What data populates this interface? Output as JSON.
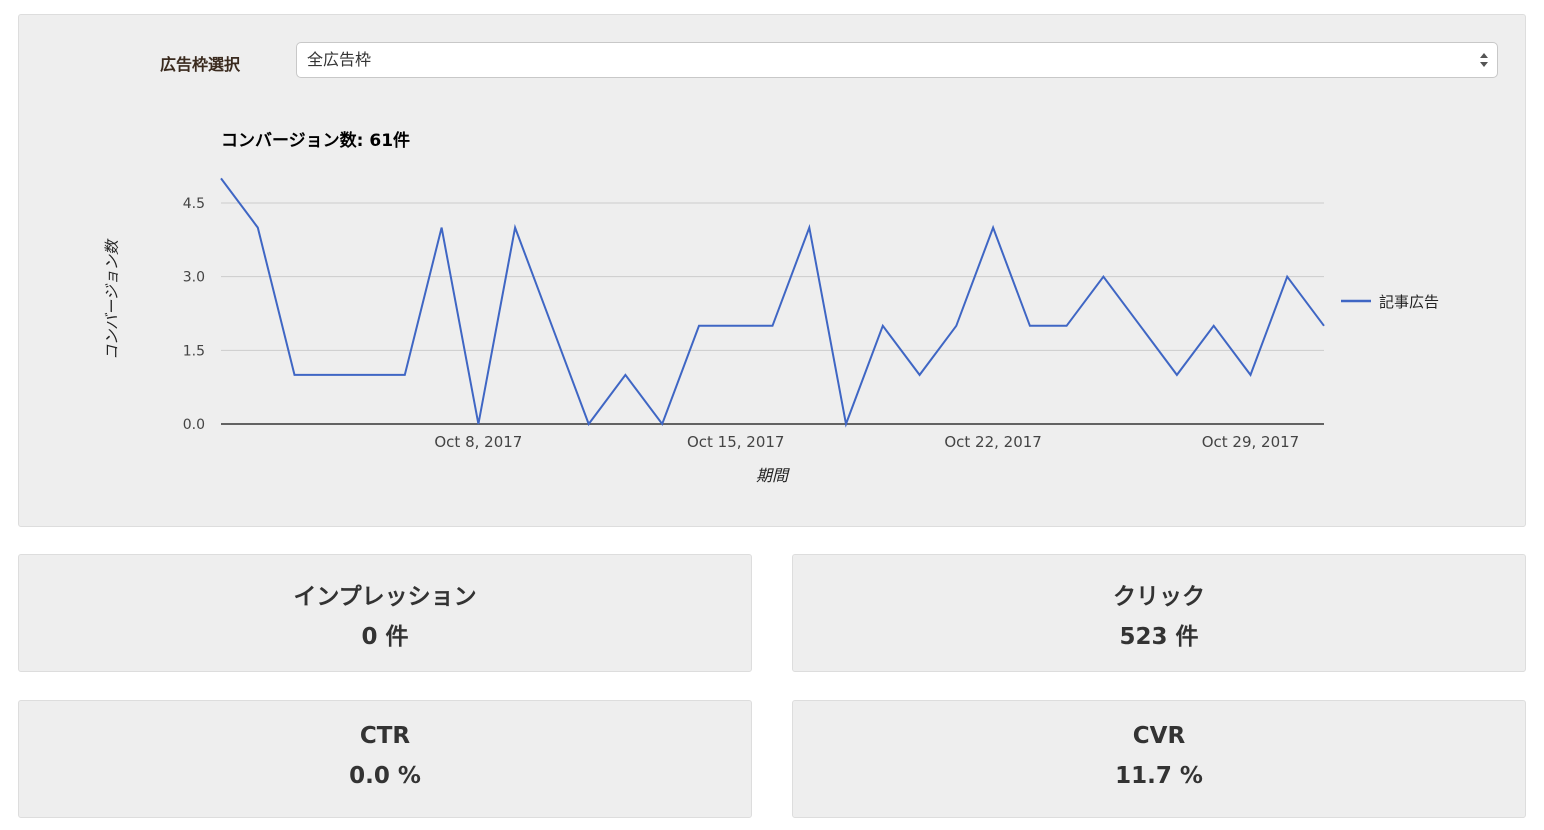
{
  "selector": {
    "label": "広告枠選択",
    "selected": "全広告枠"
  },
  "chart_data": {
    "type": "line",
    "title": "コンバージョン数: 61件",
    "xlabel": "期間",
    "ylabel": "コンバージョン数",
    "ylim": [
      0,
      4.5
    ],
    "yticks": [
      "0.0",
      "1.5",
      "3.0",
      "4.5"
    ],
    "xtick_labels": [
      "Oct 8, 2017",
      "Oct 15, 2017",
      "Oct 22, 2017",
      "Oct 29, 2017"
    ],
    "x": [
      "Oct 1, 2017",
      "Oct 2, 2017",
      "Oct 3, 2017",
      "Oct 4, 2017",
      "Oct 5, 2017",
      "Oct 6, 2017",
      "Oct 7, 2017",
      "Oct 8, 2017",
      "Oct 9, 2017",
      "Oct 10, 2017",
      "Oct 11, 2017",
      "Oct 12, 2017",
      "Oct 13, 2017",
      "Oct 14, 2017",
      "Oct 15, 2017",
      "Oct 16, 2017",
      "Oct 17, 2017",
      "Oct 18, 2017",
      "Oct 19, 2017",
      "Oct 20, 2017",
      "Oct 21, 2017",
      "Oct 22, 2017",
      "Oct 23, 2017",
      "Oct 24, 2017",
      "Oct 25, 2017",
      "Oct 26, 2017",
      "Oct 27, 2017",
      "Oct 28, 2017",
      "Oct 29, 2017",
      "Oct 30, 2017",
      "Oct 31, 2017"
    ],
    "series": [
      {
        "name": "記事広告",
        "color": "#3f66c4",
        "values": [
          5,
          4,
          1,
          1,
          1,
          1,
          4,
          0,
          4,
          2,
          0,
          1,
          0,
          2,
          2,
          2,
          4,
          0,
          2,
          1,
          2,
          4,
          2,
          2,
          3,
          2,
          1,
          2,
          1,
          3,
          2
        ]
      }
    ],
    "grid": true,
    "legend": "right"
  },
  "cards": {
    "impressions": {
      "title": "インプレッション",
      "value": "0 件"
    },
    "clicks": {
      "title": "クリック",
      "value": "523 件"
    },
    "ctr": {
      "title": "CTR",
      "value": "0.0 %"
    },
    "cvr": {
      "title": "CVR",
      "value": "11.7 %"
    }
  }
}
